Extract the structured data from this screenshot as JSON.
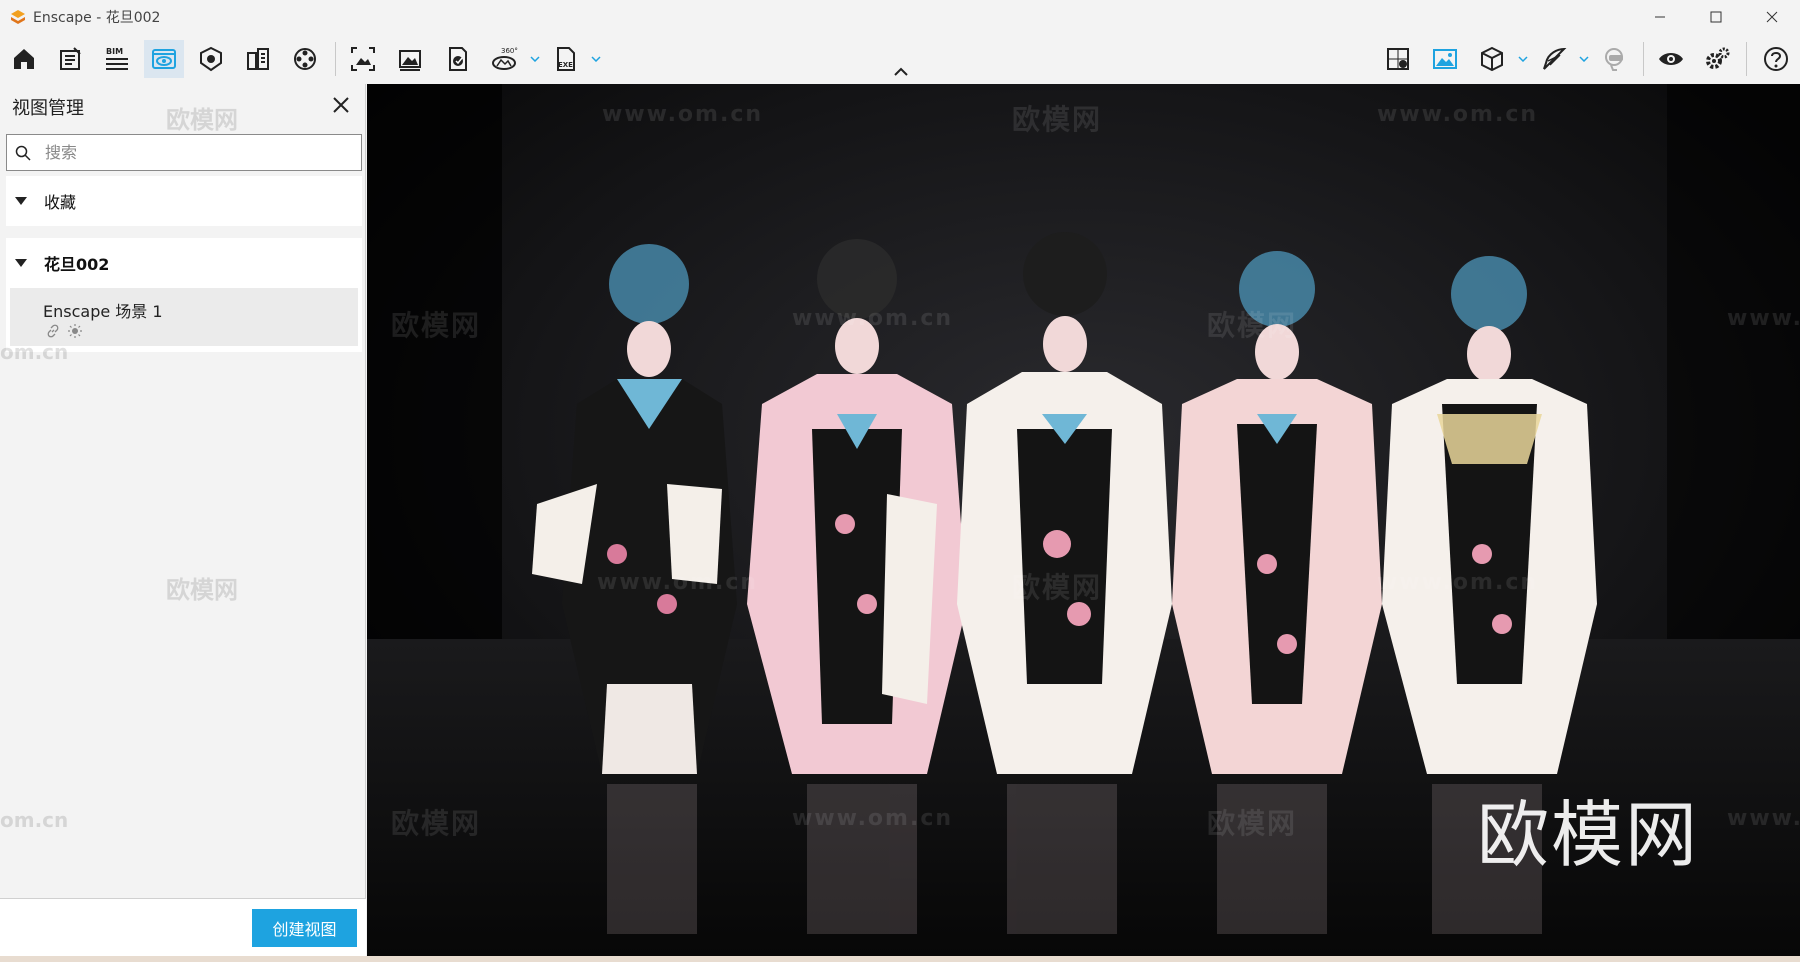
{
  "window": {
    "title": "Enscape - 花旦002",
    "controls": [
      "minimize-icon",
      "maximize-icon",
      "close-icon"
    ]
  },
  "toolbar": {
    "left_tools": [
      "home-icon",
      "notes-icon",
      "bim-icon",
      "view-management-icon",
      "material-editor-icon",
      "site-context-icon",
      "asset-library-icon"
    ],
    "bim_label": "BIM",
    "capture_tools": [
      "screenshot-icon",
      "batch-render-icon",
      "panorama-icon",
      "360-icon",
      "exe-export-icon"
    ],
    "label_360": "360°",
    "label_exe": "EXE",
    "right_tools": [
      "map-icon",
      "image-settings-icon",
      "cube-icon",
      "feather-icon",
      "vr-headset-icon",
      "eye-icon",
      "settings-icon",
      "help-icon"
    ],
    "accent": "#1ea3e0"
  },
  "sidebar": {
    "title": "视图管理",
    "search_placeholder": "搜索",
    "groups": [
      {
        "label": "收藏",
        "expanded": true,
        "items": []
      },
      {
        "label": "花旦002",
        "expanded": true,
        "items": [
          {
            "name": "Enscape 场景 1"
          }
        ]
      }
    ],
    "create_button": "创建视图"
  },
  "viewport": {
    "brand_watermark": "欧模网",
    "url_watermark": "www.om.cn",
    "url_fragment": "om.cn",
    "url_prefix": "www.o"
  }
}
